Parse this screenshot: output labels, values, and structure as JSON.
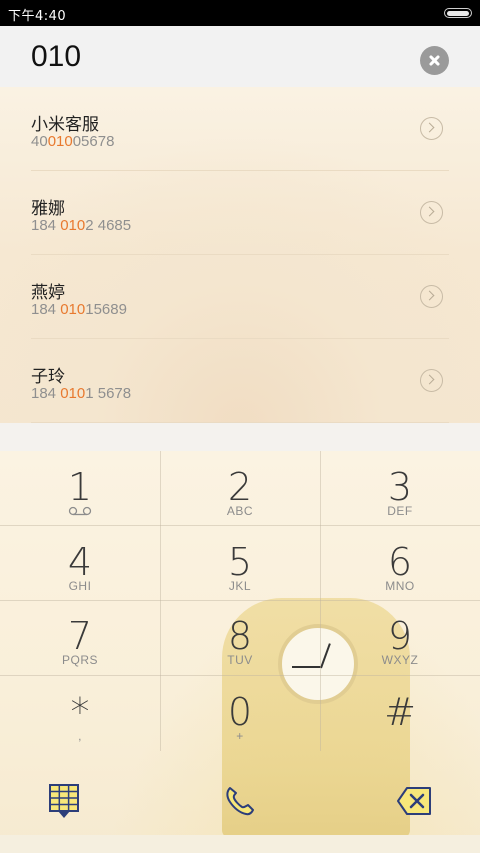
{
  "status": {
    "time": "下午4:40"
  },
  "search": {
    "query": "010"
  },
  "results": [
    {
      "name": "小米客服",
      "pre": "40",
      "hl": "010",
      "post": "05678"
    },
    {
      "name": "雅娜",
      "pre": "184 ",
      "hl": "010",
      "post": "2 4685"
    },
    {
      "name": "燕婷",
      "pre": "184 ",
      "hl": "010",
      "post": "15689"
    },
    {
      "name": "子玲",
      "pre": "184 ",
      "hl": "010",
      "post": "1 5678"
    }
  ],
  "keys": [
    {
      "digit": "1",
      "letters": ""
    },
    {
      "digit": "2",
      "letters": "ABC"
    },
    {
      "digit": "3",
      "letters": "DEF"
    },
    {
      "digit": "4",
      "letters": "GHI"
    },
    {
      "digit": "5",
      "letters": "JKL"
    },
    {
      "digit": "6",
      "letters": "MNO"
    },
    {
      "digit": "7",
      "letters": "PQRS"
    },
    {
      "digit": "8",
      "letters": "TUV"
    },
    {
      "digit": "9",
      "letters": "WXYZ"
    },
    {
      "digit": "*",
      "letters": ","
    },
    {
      "digit": "0",
      "letters": "+"
    },
    {
      "digit": "#",
      "letters": ""
    }
  ],
  "icons": {
    "voicemail": "voicemail-icon",
    "dialpad": "dialpad-icon",
    "call": "phone-icon",
    "delete": "backspace-icon",
    "clear": "clear-icon",
    "arrow": "chevron-right-icon"
  },
  "colors": {
    "highlight": "#e8792f",
    "accent_navy": "#2c3e7a",
    "accent_yellow": "#f7e77a"
  }
}
